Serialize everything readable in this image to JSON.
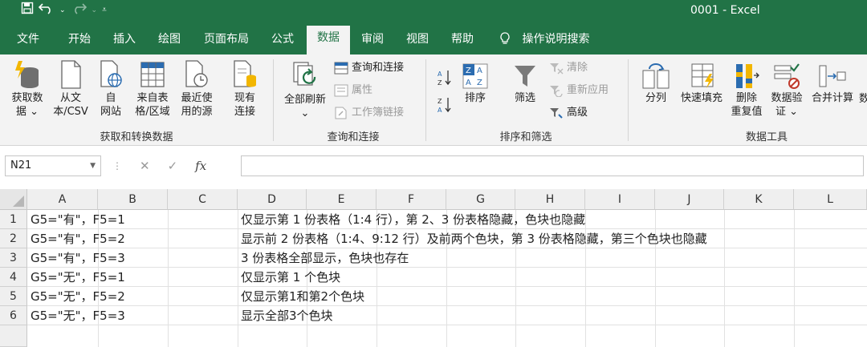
{
  "window": {
    "title": "0001  -  Excel"
  },
  "quick_access": {
    "save_icon": "save-icon",
    "undo_icon": "undo-icon",
    "redo_icon": "redo-icon",
    "customize_icon": "customize-qat-icon"
  },
  "tabs": [
    "文件",
    "开始",
    "插入",
    "绘图",
    "页面布局",
    "公式",
    "数据",
    "审阅",
    "视图",
    "帮助"
  ],
  "active_tab": "数据",
  "tell_me": "操作说明搜索",
  "ribbon": {
    "get_data": "获取数\n据 ⌄",
    "from_text": "从文\n本/CSV",
    "from_web": "自\n网站",
    "from_table": "来自表\n格/区域",
    "recent_sources": "最近使\n用的源",
    "existing_connections": "现有\n连接",
    "group_get_transform": "获取和转换数据",
    "refresh_all": "全部刷新\n⌄",
    "queries_connections": "查询和连接",
    "properties": "属性",
    "edit_links": "工作簿链接",
    "group_queries": "查询和连接",
    "sort_az": "A→Z",
    "sort_za": "Z→A",
    "sort": "排序",
    "filter": "筛选",
    "clear": "清除",
    "reapply": "重新应用",
    "advanced": "高级",
    "group_sort_filter": "排序和筛选",
    "text_to_columns": "分列",
    "flash_fill": "快速填充",
    "remove_duplicates": "删除\n重复值",
    "data_validation": "数据验\n证 ⌄",
    "consolidate": "合并计算",
    "more": "数",
    "group_data_tools": "数据工具"
  },
  "formula_bar": {
    "name_box": "N21",
    "cancel": "✕",
    "enter": "✓",
    "fx": "fx",
    "value": ""
  },
  "grid": {
    "columns": [
      "A",
      "B",
      "C",
      "D",
      "E",
      "F",
      "G",
      "H",
      "I",
      "J",
      "K",
      "L"
    ],
    "rows": [
      "1",
      "2",
      "3",
      "4",
      "5",
      "6"
    ],
    "cells": [
      {
        "a": "G5=\"有\"，F5=1",
        "d": "仅显示第 1 份表格（1:4 行），第 2、3 份表格隐藏，色块也隐藏"
      },
      {
        "a": "G5=\"有\"，F5=2",
        "d": "显示前 2 份表格（1:4、9:12 行）及前两个色块，第 3 份表格隐藏，第三个色块也隐藏"
      },
      {
        "a": "G5=\"有\"，F5=3",
        "d": "3 份表格全部显示，色块也存在"
      },
      {
        "a": "G5=\"无\"，F5=1",
        "d": "仅显示第 1 个色块"
      },
      {
        "a": "G5=\"无\"，F5=2",
        "d": "仅显示第1和第2个色块"
      },
      {
        "a": "G5=\"无\"，F5=3",
        "d": "显示全部3个色块"
      }
    ]
  },
  "colors": {
    "brand": "#217346",
    "ribbon_bg": "#f3f3f3",
    "grid_line": "#e1e1e1"
  }
}
